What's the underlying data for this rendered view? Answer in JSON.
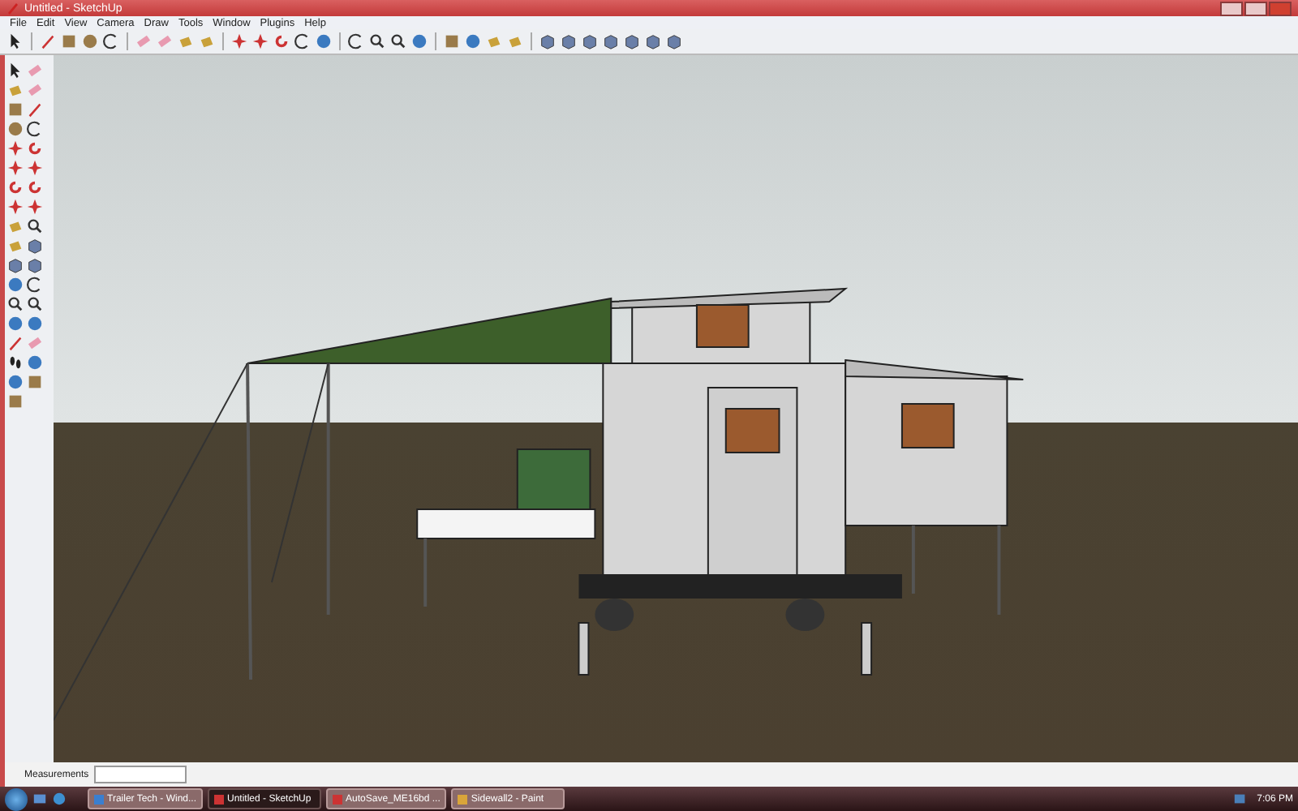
{
  "window": {
    "title": "Untitled - SketchUp"
  },
  "menu": [
    "File",
    "Edit",
    "View",
    "Camera",
    "Draw",
    "Tools",
    "Window",
    "Plugins",
    "Help"
  ],
  "status_bar": {
    "label": "Measurements"
  },
  "taskbar": {
    "items": [
      {
        "label": "Trailer Tech - Wind...",
        "selected": false,
        "kind": "browser"
      },
      {
        "label": "Untitled - SketchUp",
        "selected": true,
        "kind": "sketchup"
      },
      {
        "label": "AutoSave_ME16bd ...",
        "selected": false,
        "kind": "sketchup"
      },
      {
        "label": "Sidewall2 - Paint",
        "selected": false,
        "kind": "paint"
      }
    ],
    "clock": "7:06 PM"
  }
}
